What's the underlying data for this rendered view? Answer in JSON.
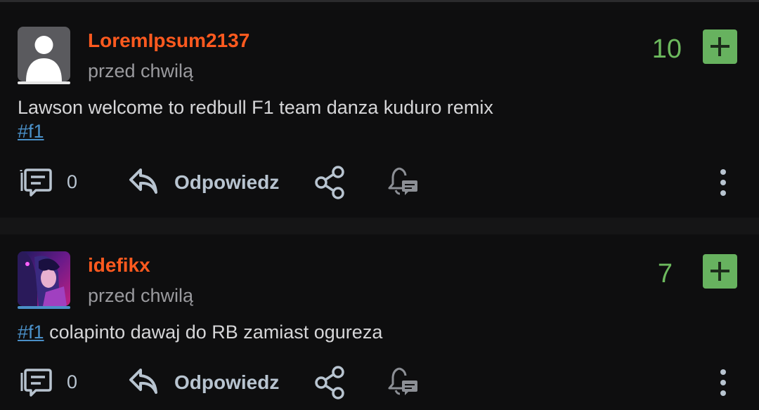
{
  "posts": [
    {
      "username": "LoremIpsum2137",
      "time": "przed chwilą",
      "score": "10",
      "text": "Lawson welcome to redbull F1 team danza kuduro remix",
      "tag": "#f1",
      "comments": "0",
      "reply_label": "Odpowiedz",
      "avatar": "default-user-icon"
    },
    {
      "username": "idefikx",
      "time": "przed chwilą",
      "score": "7",
      "text": "colapinto dawaj do RB zamiast ogureza",
      "tag": "#f1",
      "comments": "0",
      "reply_label": "Odpowiedz",
      "avatar": "anime-avatar"
    }
  ],
  "colors": {
    "username": "#ff5a1f",
    "score": "#6dba5e",
    "plus_button": "#67b25f",
    "tag": "#4a90c8",
    "action": "#b8c4d0"
  }
}
